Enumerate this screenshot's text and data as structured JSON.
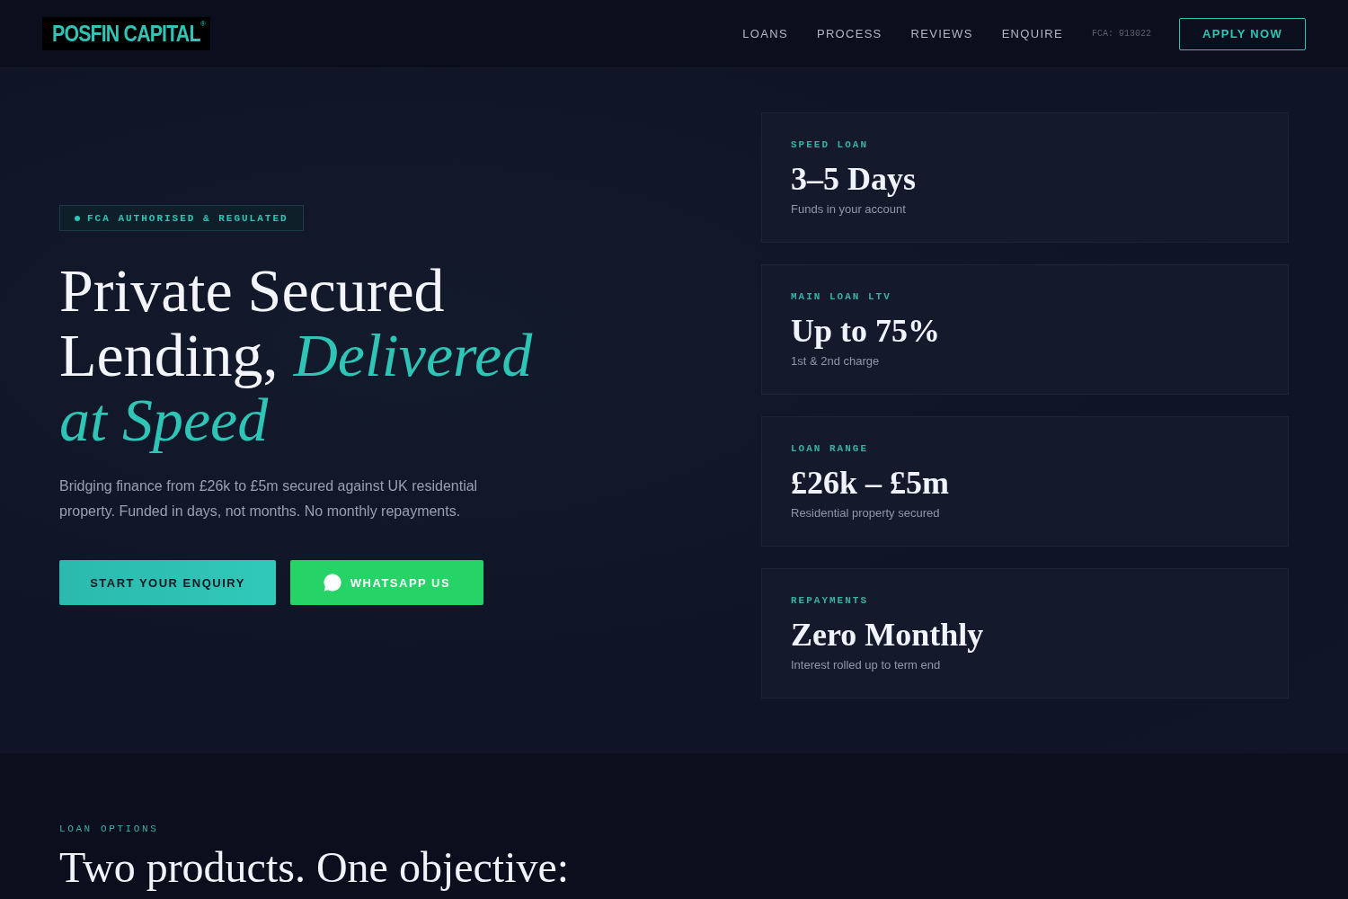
{
  "header": {
    "logo": {
      "text": "POSFIN CAPITAL",
      "mark": "®"
    },
    "nav": [
      "LOANS",
      "PROCESS",
      "REVIEWS",
      "ENQUIRE"
    ],
    "license": "FCA: 913022",
    "cta": "APPLY NOW"
  },
  "hero": {
    "badge": "FCA AUTHORISED & REGULATED",
    "title": "Private Secured Lending, *Delivered at Speed*",
    "description": "Bridging finance from £26k to £5m secured against UK residential property. Funded in days, not months. No monthly repayments.",
    "buttons": [
      {
        "kind": "primary",
        "label": "START YOUR ENQUIRY"
      },
      {
        "kind": "whatsapp",
        "label": "WHATSAPP US"
      }
    ]
  },
  "stats": [
    {
      "label": "SPEED LOAN",
      "value": "3–5 Days",
      "note": "Funds in your account"
    },
    {
      "label": "MAIN LOAN LTV",
      "value": "Up to 75%",
      "note": "1st & 2nd charge"
    },
    {
      "label": "LOAN RANGE",
      "value": "£26k – £5m",
      "note": "Residential property secured"
    },
    {
      "label": "REPAYMENTS",
      "value": "Zero Monthly",
      "note": "Interest rolled up to term end"
    }
  ],
  "loan_options": {
    "eyebrow": "LOAN OPTIONS",
    "heading": "Two products. One objective:"
  }
}
